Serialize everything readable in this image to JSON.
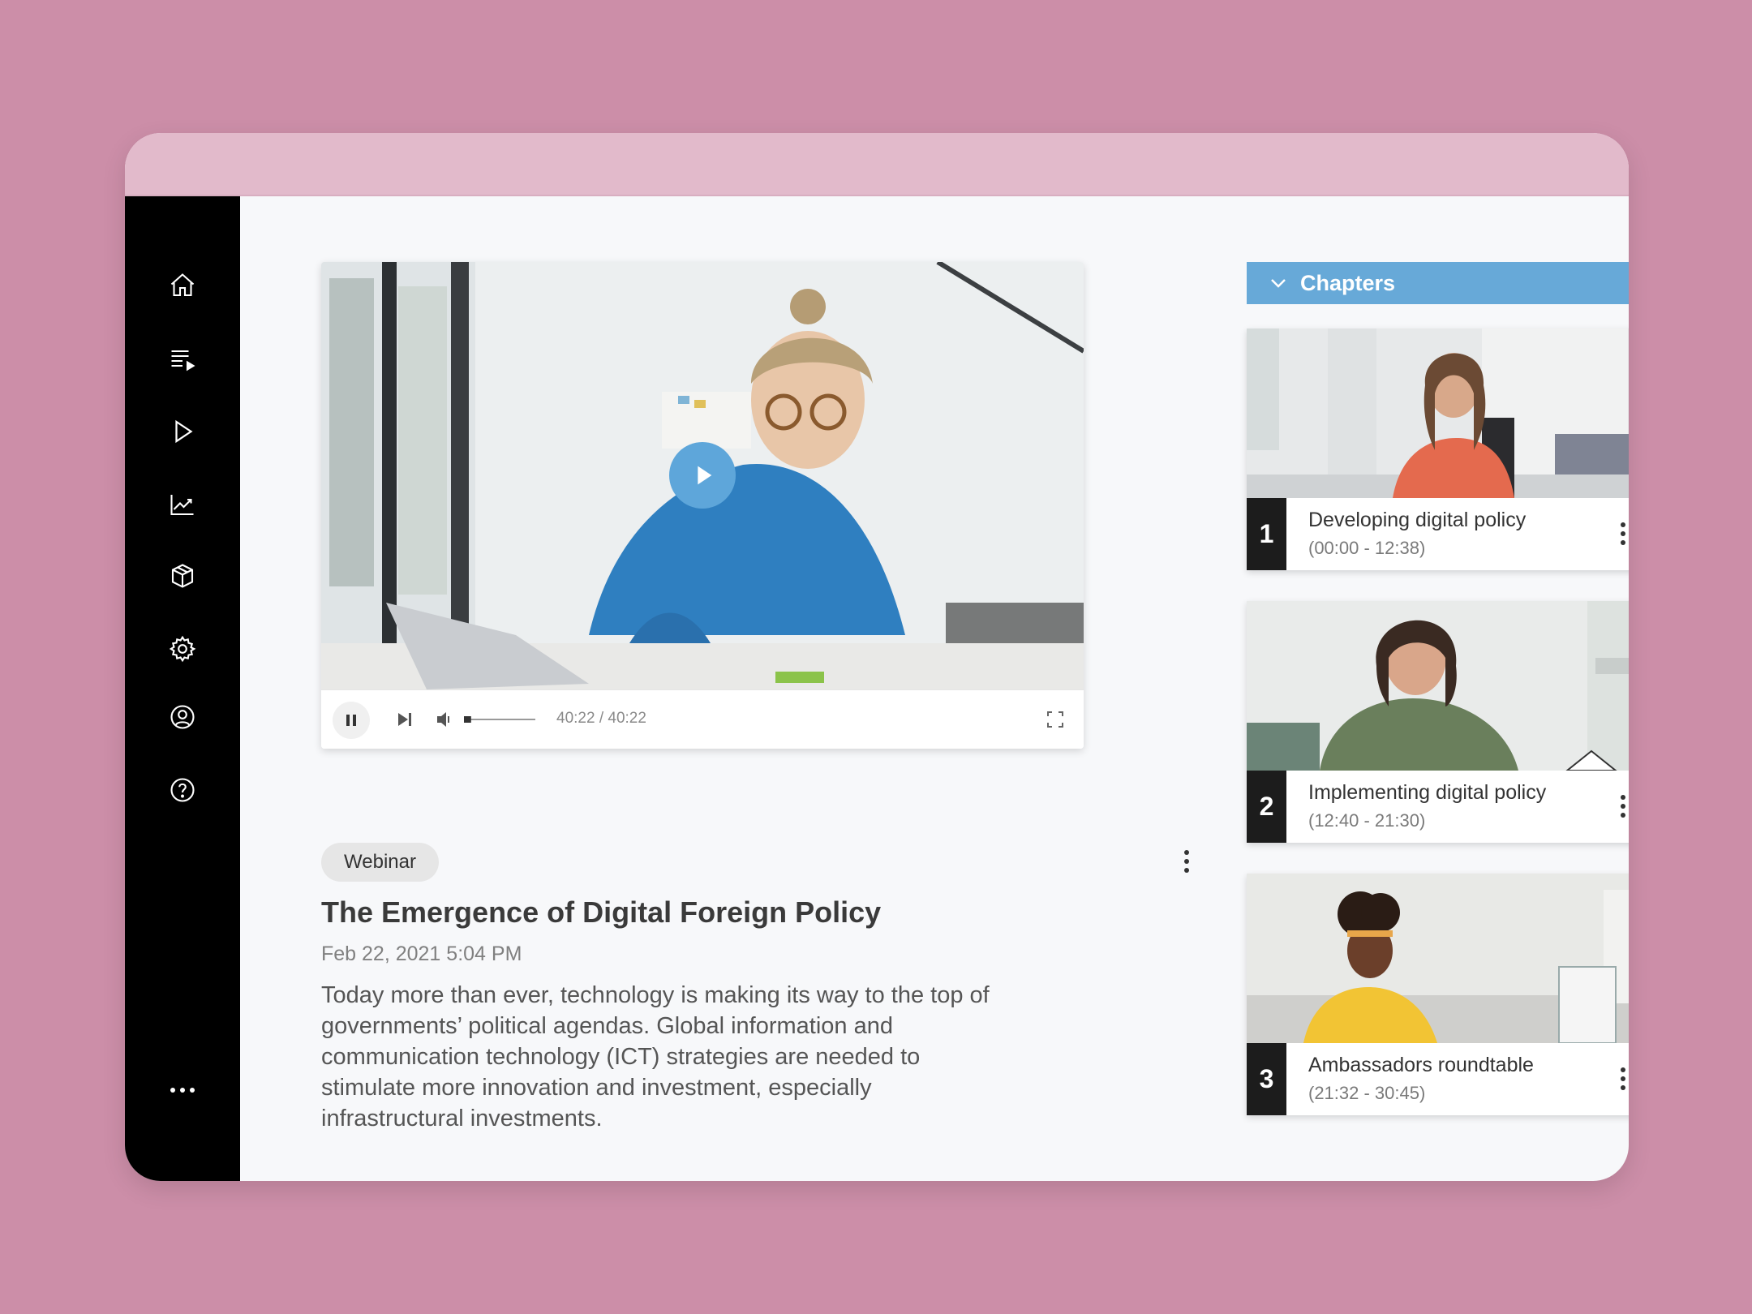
{
  "sidebar": {
    "icons": [
      "home-icon",
      "playlist-icon",
      "play-icon",
      "analytics-icon",
      "box-icon",
      "settings-icon",
      "account-icon",
      "help-icon",
      "more-icon"
    ]
  },
  "player": {
    "time": "40:22 / 40:22",
    "volume_level": 0.1,
    "accent": "#5ea6da"
  },
  "video": {
    "tag": "Webinar",
    "title": "The Emergence of Digital Foreign Policy",
    "date": "Feb 22, 2021 5:04 PM",
    "description": "Today more than ever, technology is making its way to the top of governments’ political agendas. Global information and communication technology (ICT) strategies are needed to stimulate more innovation and investment, especially infrastructural investments."
  },
  "chapters": {
    "header": "Chapters",
    "header_color": "#67a9d8",
    "items": [
      {
        "number": "1",
        "title": "Developing digital policy",
        "range": "(00:00 - 12:38)"
      },
      {
        "number": "2",
        "title": "Implementing digital policy",
        "range": "(12:40 - 21:30)"
      },
      {
        "number": "3",
        "title": "Ambassadors roundtable",
        "range": "(21:32 - 30:45)"
      }
    ]
  }
}
